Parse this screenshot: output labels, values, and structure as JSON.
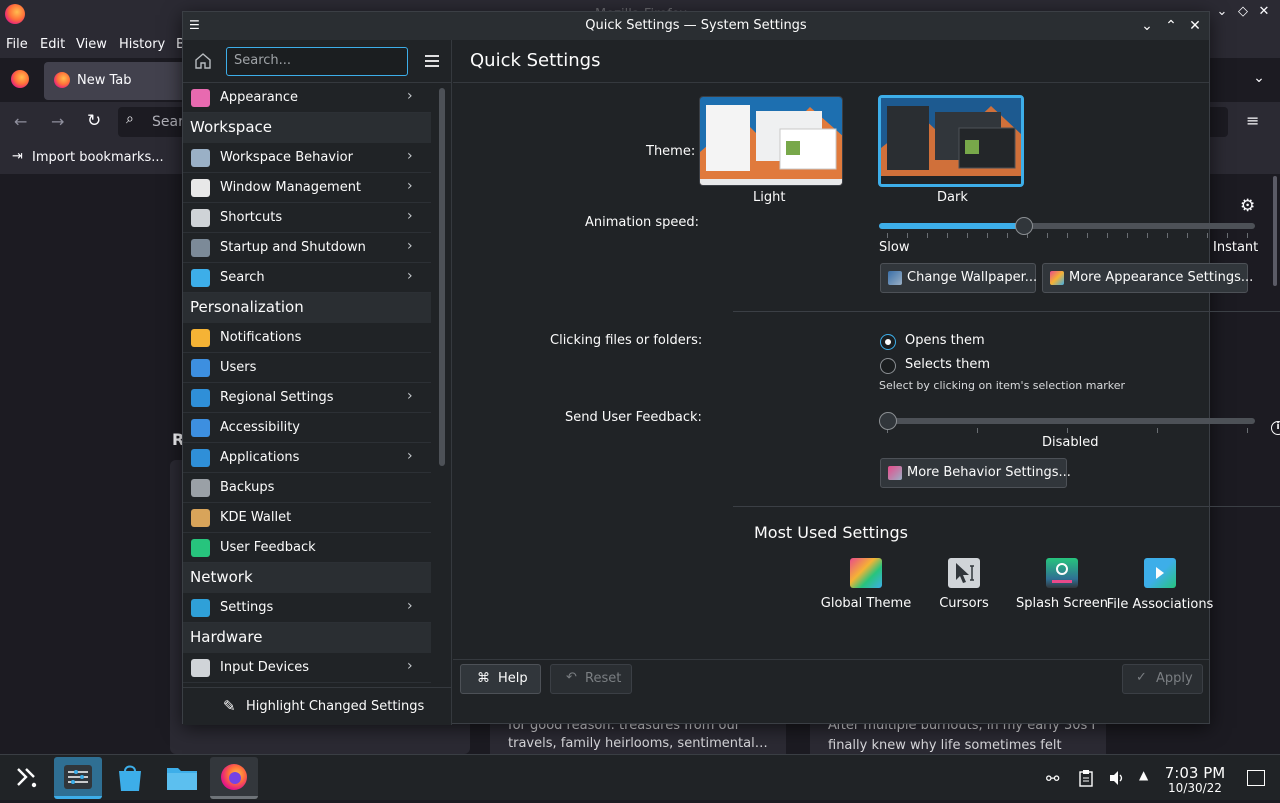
{
  "firefox": {
    "title": "Mozilla Firefox",
    "menu": [
      "File",
      "Edit",
      "View",
      "History",
      "B"
    ],
    "tab_label": "New Tab",
    "search_placeholder": "Sear",
    "bookmark": "Import bookmarks...",
    "section_letter": "R",
    "card1_text_1": "for good reason: treasures from our",
    "card1_text_2": "travels, family heirlooms, sentimental…",
    "card2_text_1": "After multiple burnouts, in my early 30s I",
    "card2_text_2": "finally knew why life sometimes felt"
  },
  "window": {
    "title": "Quick Settings — System Settings"
  },
  "sidebar": {
    "search_placeholder": "Search...",
    "items": [
      {
        "type": "item",
        "label": "Appearance",
        "icon": "appearance-icon",
        "color": "#e86ab0",
        "chevron": true
      },
      {
        "type": "category",
        "label": "Workspace"
      },
      {
        "type": "item",
        "label": "Workspace Behavior",
        "icon": "workspace-behavior-icon",
        "color": "#9ab0c6",
        "chevron": true
      },
      {
        "type": "item",
        "label": "Window Management",
        "icon": "window-management-icon",
        "color": "#e8e8e8",
        "chevron": true
      },
      {
        "type": "item",
        "label": "Shortcuts",
        "icon": "keyboard-icon",
        "color": "#cfd3d7",
        "chevron": true
      },
      {
        "type": "item",
        "label": "Startup and Shutdown",
        "icon": "startup-icon",
        "color": "#7c8a98",
        "chevron": true
      },
      {
        "type": "item",
        "label": "Search",
        "icon": "search-icon",
        "color": "#3daee9",
        "chevron": true
      },
      {
        "type": "category",
        "label": "Personalization"
      },
      {
        "type": "item",
        "label": "Notifications",
        "icon": "bell-icon",
        "color": "#f5b335",
        "chevron": false
      },
      {
        "type": "item",
        "label": "Users",
        "icon": "users-icon",
        "color": "#3d8fe0",
        "chevron": false
      },
      {
        "type": "item",
        "label": "Regional Settings",
        "icon": "regional-icon",
        "color": "#2f8fd8",
        "chevron": true
      },
      {
        "type": "item",
        "label": "Accessibility",
        "icon": "accessibility-icon",
        "color": "#3d8fe0",
        "chevron": false
      },
      {
        "type": "item",
        "label": "Applications",
        "icon": "applications-icon",
        "color": "#2f8fd8",
        "chevron": true
      },
      {
        "type": "item",
        "label": "Backups",
        "icon": "backups-icon",
        "color": "#9aa0a6",
        "chevron": false
      },
      {
        "type": "item",
        "label": "KDE Wallet",
        "icon": "wallet-icon",
        "color": "#d8a45a",
        "chevron": false
      },
      {
        "type": "item",
        "label": "User Feedback",
        "icon": "feedback-icon",
        "color": "#27c47d",
        "chevron": false
      },
      {
        "type": "category",
        "label": "Network"
      },
      {
        "type": "item",
        "label": "Settings",
        "icon": "globe-icon",
        "color": "#2fa0d8",
        "chevron": true
      },
      {
        "type": "category",
        "label": "Hardware"
      },
      {
        "type": "item",
        "label": "Input Devices",
        "icon": "mouse-icon",
        "color": "#d0d4d8",
        "chevron": true
      }
    ],
    "footer_label": "Highlight Changed Settings"
  },
  "main": {
    "title": "Quick Settings",
    "theme_label": "Theme:",
    "theme_light": "Light",
    "theme_dark": "Dark",
    "selected_theme": "Dark",
    "animation_label": "Animation speed:",
    "animation_value": 0.38,
    "slow_label": "Slow",
    "instant_label": "Instant",
    "wallpaper_button": "Change Wallpaper...",
    "more_appearance_button": "More Appearance Settings...",
    "clicking_label": "Clicking files or folders:",
    "opens_label": "Opens them",
    "selects_label": "Selects them",
    "selected_click": "Opens them",
    "select_hint": "Select by clicking on item's selection marker",
    "feedback_label": "Send User Feedback:",
    "feedback_value": 0,
    "feedback_state": "Disabled",
    "more_behavior_button": "More Behavior Settings...",
    "most_used_title": "Most Used Settings",
    "most_used": [
      {
        "label": "Global Theme",
        "icon": "global-theme-icon"
      },
      {
        "label": "Cursors",
        "icon": "cursors-icon"
      },
      {
        "label": "Splash Screen",
        "icon": "splash-screen-icon"
      },
      {
        "label": "File Associations",
        "icon": "file-associations-icon"
      }
    ],
    "help_button": "Help",
    "reset_button": "Reset",
    "apply_button": "Apply"
  },
  "taskbar": {
    "time": "7:03 PM",
    "date": "10/30/22"
  },
  "colors": {
    "accent": "#3daee9",
    "window_bg": "#202326",
    "firefox_bg": "#1c1b22"
  }
}
